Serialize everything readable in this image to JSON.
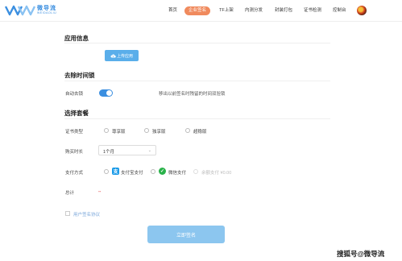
{
  "header": {
    "logo_name": "微导流",
    "logo_sub": "WEIDAOLIU",
    "nav": [
      "首页",
      "企业签名",
      "TF上架",
      "内测分发",
      "封装打包",
      "证书检测",
      "控制台"
    ]
  },
  "app_info": {
    "title": "应用信息",
    "upload_label": "上传应用"
  },
  "time_lock": {
    "title": "去除时间锁",
    "auto_label": "自动去锁",
    "auto_enabled": true,
    "hint": "移出以前签名时残留的时间双验锁"
  },
  "package": {
    "title": "选择套餐",
    "cert_label": "证书类型",
    "cert_options": [
      "尊享版",
      "独享版",
      "超稳版"
    ],
    "duration_label": "购买时长",
    "duration_value": "1个月",
    "payment_label": "支付方式",
    "payment_options": [
      "支付宝支付",
      "微信支付",
      "余额支付 ¥0.00"
    ],
    "total_label": "总计",
    "total_value": "--"
  },
  "agreement": "用户签名协议",
  "submit_label": "立即签名",
  "watermark": "搜狐号@微导流",
  "colors": {
    "primary": "#3b8fe0",
    "nav_active": "#f08a5d",
    "submit": "#8cc6ef",
    "alipay": "#1a9ae8",
    "wechat": "#2ab24a"
  }
}
